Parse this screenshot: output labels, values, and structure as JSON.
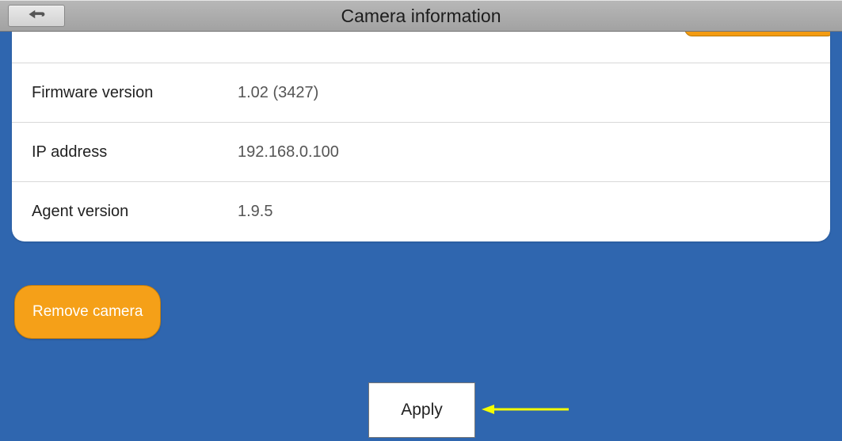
{
  "header": {
    "title": "Camera information"
  },
  "info": {
    "rows": [
      {
        "label": "Firmware version",
        "value": "1.02 (3427)"
      },
      {
        "label": "IP address",
        "value": "192.168.0.100"
      },
      {
        "label": "Agent version",
        "value": "1.9.5"
      }
    ]
  },
  "buttons": {
    "remove": "Remove camera",
    "apply": "Apply"
  },
  "colors": {
    "accent_orange": "#f5a018",
    "bg_blue": "#2f66af"
  }
}
